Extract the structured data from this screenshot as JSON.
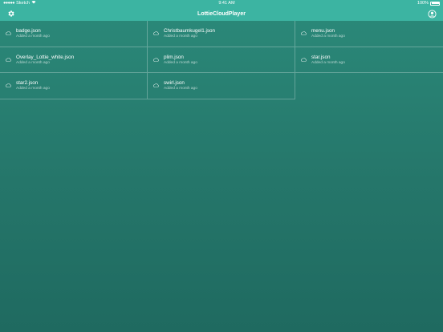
{
  "status_bar": {
    "carrier": "Sketch",
    "time": "9:41 AM",
    "battery": "100%"
  },
  "nav": {
    "title": "LottieCloudPlayer",
    "left_icon": "gear-icon",
    "right_icon": "user-circle-icon"
  },
  "files": [
    {
      "name": "badge.json",
      "added": "Added a month ago"
    },
    {
      "name": "Christbaumkugel1.json",
      "added": "Added a month ago"
    },
    {
      "name": "menu.json",
      "added": "Added a month ago"
    },
    {
      "name": "Overlay_Lottie_white.json",
      "added": "Added a month ago"
    },
    {
      "name": "plim.json",
      "added": "Added a month ago"
    },
    {
      "name": "star.json",
      "added": "Added a month ago"
    },
    {
      "name": "star2.json",
      "added": "Added a month ago"
    },
    {
      "name": "swirl.json",
      "added": "Added a month ago"
    }
  ],
  "colors": {
    "accent": "#3cb4a2",
    "background": "#25766a"
  }
}
